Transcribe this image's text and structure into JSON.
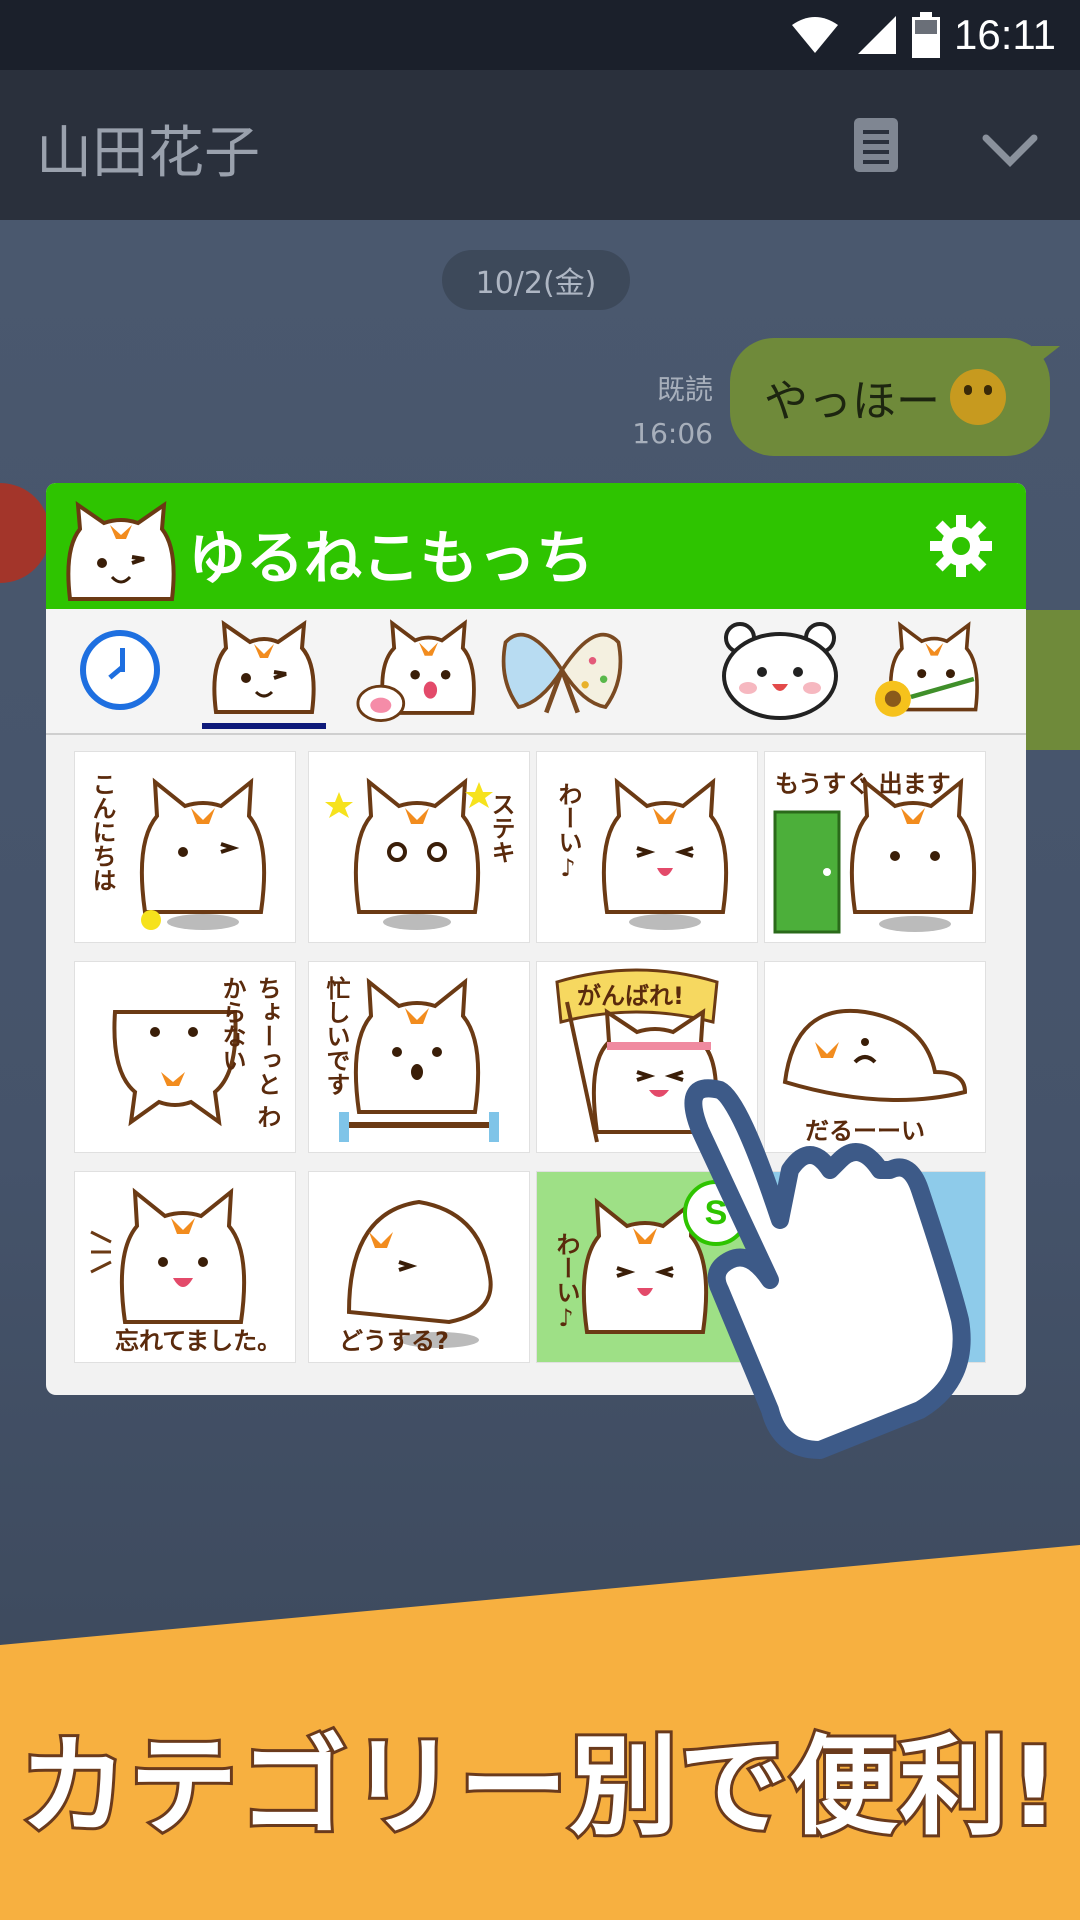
{
  "status_bar": {
    "time": "16:11"
  },
  "header": {
    "contact_name": "山田花子"
  },
  "chat": {
    "date_label": "10/2(金)",
    "read_label": "既読",
    "sent_time": "16:06",
    "message_text": "やっほー"
  },
  "sticker_panel": {
    "pack_title": "ゆるねこもっち",
    "tabs": [
      "recent",
      "cat-wink",
      "cat-paw",
      "ribbon",
      "bear",
      "cat-sunflower"
    ],
    "stickers": [
      {
        "caption": "こんにちは"
      },
      {
        "caption": "ステキ"
      },
      {
        "caption": "わーい♪"
      },
      {
        "caption": "もうすぐ 出ます"
      },
      {
        "caption": "ちょーっと わからない"
      },
      {
        "caption": "忙しいです"
      },
      {
        "caption": "がんばれ!"
      },
      {
        "caption": "だるーーい"
      },
      {
        "caption": "忘れてました。"
      },
      {
        "caption": "どうする?"
      },
      {
        "caption": "わーい♪"
      },
      {
        "caption": ""
      }
    ],
    "badge_letter": "S"
  },
  "banner": {
    "text": "カテゴリー別で便利!"
  },
  "colors": {
    "accent_green": "#2ec400",
    "banner_orange": "#f7b040",
    "tab_indicator": "#0e1a7a"
  }
}
